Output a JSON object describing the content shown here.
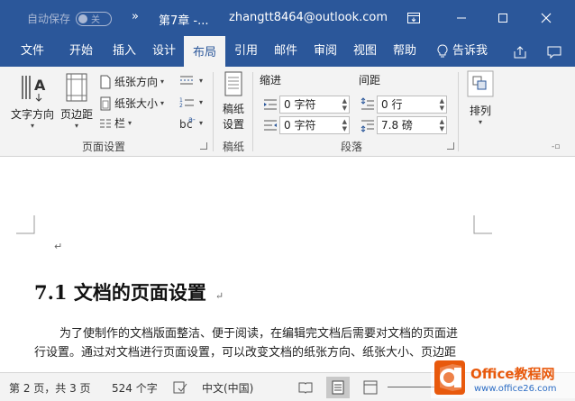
{
  "titlebar": {
    "autosave_label": "自动保存",
    "autosave_state": "关",
    "qat_more": "»",
    "doc_title": "第7章 -...",
    "account": "zhangtt8464@outlook.com"
  },
  "tabs": [
    {
      "label": "文件"
    },
    {
      "label": "开始"
    },
    {
      "label": "插入"
    },
    {
      "label": "设计"
    },
    {
      "label": "布局"
    },
    {
      "label": "引用"
    },
    {
      "label": "邮件"
    },
    {
      "label": "审阅"
    },
    {
      "label": "视图"
    },
    {
      "label": "帮助"
    }
  ],
  "tell_me": "告诉我",
  "ribbon": {
    "page_setup": {
      "text_direction": "文字方向",
      "margins": "页边距",
      "orientation": "纸张方向",
      "size": "纸张大小",
      "columns": "栏",
      "label": "页面设置"
    },
    "draft": {
      "button": [
        "稿纸",
        "设置"
      ],
      "label": "稿纸"
    },
    "paragraph": {
      "indent_title": "缩进",
      "spacing_title": "间距",
      "indent_left": "0 字符",
      "indent_right": "0 字符",
      "spacing_before": "0 行",
      "spacing_after": "7.8 磅",
      "label": "段落"
    },
    "arrange": {
      "label": "排列"
    }
  },
  "document": {
    "para_mark": "↵",
    "heading": "7.1  文档的页面设置",
    "body_line1": "为了使制作的文档版面整洁、便于阅读，在编辑完文档后需要对文档的页面进",
    "body_line2": "行设置。通过对文档进行页面设置，可以改变文档的纸张方向、纸张大小、页边距"
  },
  "statusbar": {
    "page": "第 2 页，共 3 页",
    "words": "524 个字",
    "language": "中文(中国)"
  },
  "watermark": {
    "brand": "Office教程网",
    "url": "www.office26.com"
  },
  "colors": {
    "accent": "#2b579a",
    "ribbon_bg": "#f3f3f3",
    "watermark_orange": "#e8590c"
  }
}
